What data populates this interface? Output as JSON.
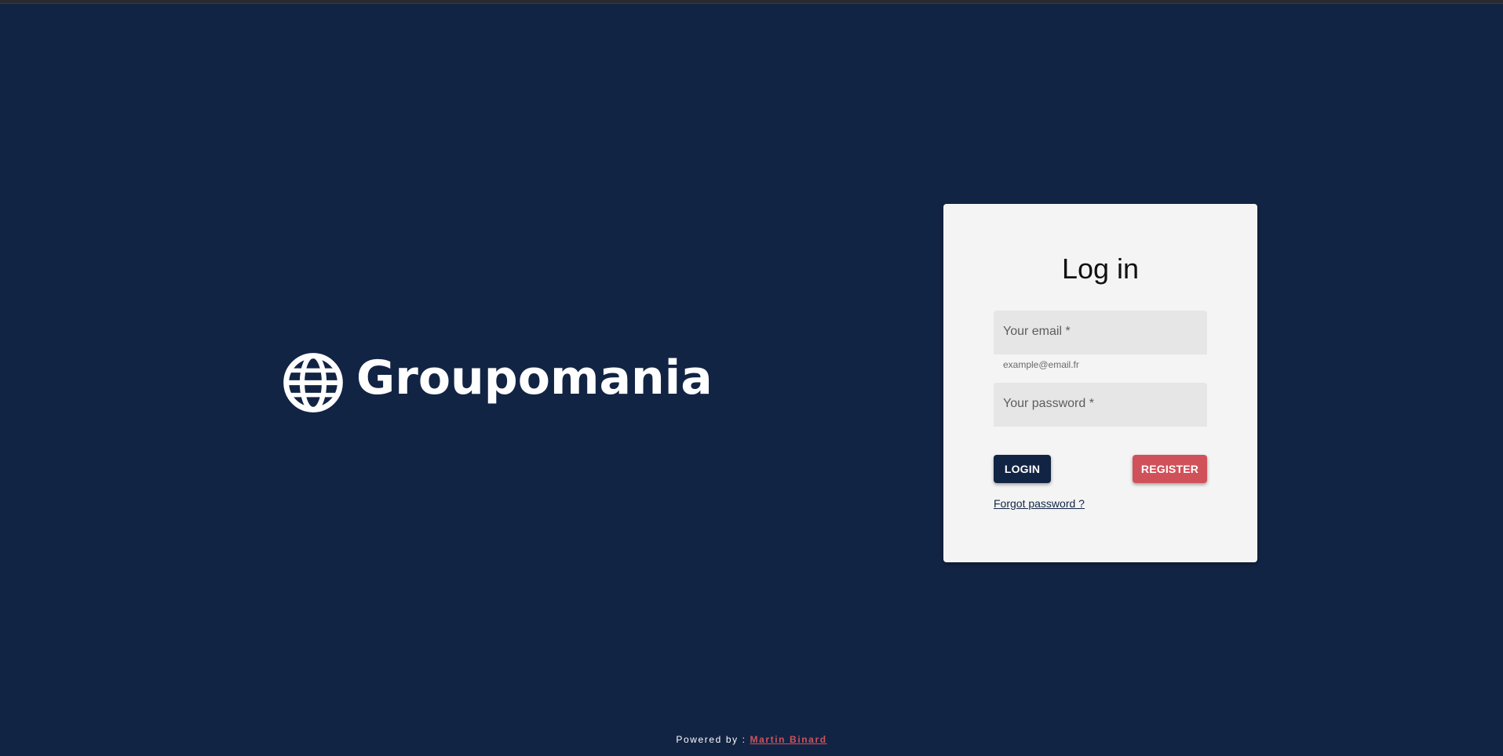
{
  "brand": {
    "name": "Groupomania",
    "logo_icon": "globe-icon"
  },
  "login_card": {
    "title": "Log in",
    "email_label": "Your email *",
    "email_value": "",
    "email_hint": "example@email.fr",
    "password_label": "Your password *",
    "password_value": "",
    "login_button": "LOGIN",
    "register_button": "REGISTER",
    "forgot_link": "Forgot password ?"
  },
  "footer": {
    "prefix": "Powered by : ",
    "author": "Martin Binard"
  },
  "colors": {
    "background": "#122444",
    "card": "#f4f4f4",
    "accent_red": "#d1515a",
    "primary_navy": "#122444"
  }
}
